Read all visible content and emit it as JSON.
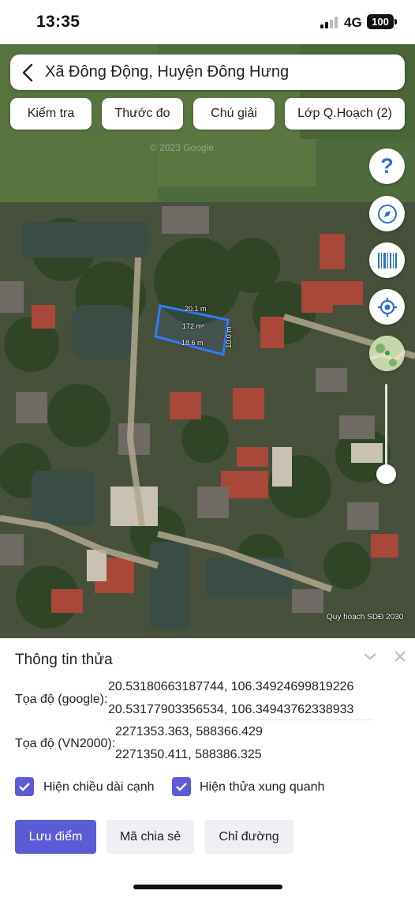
{
  "status_bar": {
    "time": "13:35",
    "network": "4G",
    "battery": "100"
  },
  "map": {
    "search_title": "Xã Đông Động, Huyện Đông Hưng",
    "chips": [
      "Kiểm tra",
      "Thước đo",
      "Chú giải",
      "Lớp Q.Hoạch (2)"
    ],
    "fab_help_symbol": "?",
    "fab_icons": [
      "help-icon",
      "compass-icon",
      "barcode-icon",
      "locate-icon",
      "layer-thumbnail-icon"
    ],
    "parcel": {
      "top_edge": "20.1 m",
      "area": "172 m²",
      "bottom_edge": "18.6 m",
      "right_edge": "10.0 m"
    },
    "watermark": "© 2023 Google",
    "credit": "Quy hoạch SDĐ 2030",
    "parcel_color": "#2f7bff"
  },
  "info_panel": {
    "title": "Thông tin thửa",
    "google_label": "Tọa độ (google):",
    "google_coords": [
      "20.53180663187744, 106.34924699819226",
      "20.53177903356534, 106.34943762338933"
    ],
    "vn2000_label": "Tọa độ (VN2000):",
    "vn2000_coords": [
      "2271353.363, 588366.429",
      "2271350.411, 588386.325"
    ],
    "checkboxes": [
      {
        "label": "Hiện chiều dài cạnh",
        "checked": true
      },
      {
        "label": "Hiện thửa xung quanh",
        "checked": true
      }
    ],
    "buttons": {
      "save": "Lưu điểm",
      "share": "Mã chia sẻ",
      "directions": "Chỉ đường"
    },
    "accent_color": "#5b5bd6"
  }
}
